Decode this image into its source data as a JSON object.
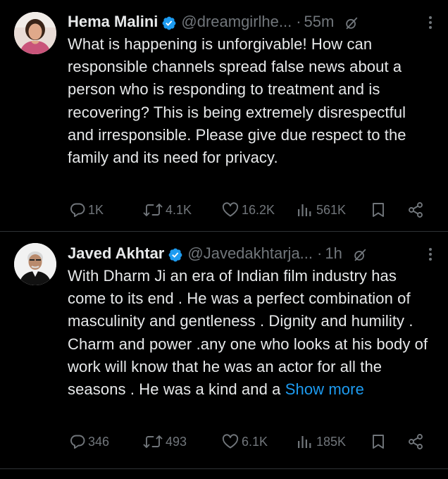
{
  "tweets": [
    {
      "author_name": "Hema Malini",
      "handle": "@dreamgirlhe...",
      "separator": "·",
      "time": "55m",
      "text": "What is happening is unforgivable! How can responsible channels spread false news about a person who is responding to treatment and is recovering? This is being extremely disrespectful and  irresponsible. Please give due respect to the family and its need for privacy.",
      "show_more": "",
      "stats": {
        "replies": "1K",
        "reposts": "4.1K",
        "likes": "16.2K",
        "views": "561K"
      }
    },
    {
      "author_name": "Javed Akhtar",
      "handle": "@Javedakhtarja...",
      "separator": "·",
      "time": "1h",
      "text": "With Dharm Ji an era of Indian film industry has come to its end . He was a perfect combination of masculinity and gentleness . Dignity and humility . Charm and power .any one who looks at his body of work will know that he was an actor for all the seasons . He was a kind and a ",
      "show_more": "Show more",
      "stats": {
        "replies": "346",
        "reposts": "493",
        "likes": "6.1K",
        "views": "185K"
      }
    }
  ],
  "colors": {
    "background": "#000000",
    "text_primary": "#e7e9ea",
    "text_secondary": "#71767b",
    "link": "#1d9bf0",
    "verified": "#1d9bf0",
    "divider": "#2f3336"
  },
  "icons": {
    "verified": "verified-badge-icon",
    "grok": "grok-icon",
    "more": "more-vertical-icon",
    "reply": "reply-icon",
    "repost": "repost-icon",
    "like": "heart-icon",
    "views": "views-icon",
    "bookmark": "bookmark-icon",
    "share": "share-icon"
  }
}
